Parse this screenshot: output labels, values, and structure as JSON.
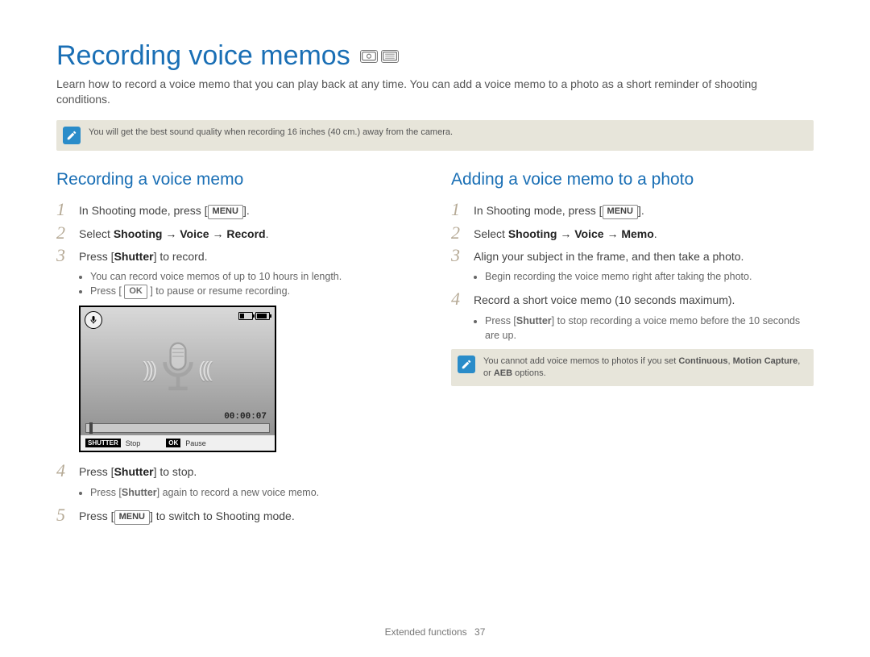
{
  "title": "Recording voice memos",
  "mode_icons": [
    "P",
    "SCENE"
  ],
  "intro": "Learn how to record a voice memo that you can play back at any time. You can add a voice memo to a photo as a short reminder of shooting conditions.",
  "top_note": "You will get the best sound quality when recording 16 inches (40 cm.) away from the camera.",
  "left": {
    "heading": "Recording a voice memo",
    "s1_a": "In Shooting mode, press [",
    "s1_key": "MENU",
    "s1_b": "].",
    "s2_a": "Select ",
    "s2_b": "Shooting → Voice → Record",
    "s2_c": ".",
    "s3_a": "Press [",
    "s3_b": "Shutter",
    "s3_c": "] to record.",
    "b1": "You can record voice memos of up to 10 hours in length.",
    "b2a": "Press [ ",
    "b2key": "OK",
    "b2b": " ] to pause or resume recording.",
    "s4_a": "Press [",
    "s4_b": "Shutter",
    "s4_c": "] to stop.",
    "b3a": "Press [",
    "b3b": "Shutter",
    "b3c": "] again to record a new voice memo.",
    "s5_a": "Press [",
    "s5_key": "MENU",
    "s5_b": "] to switch to Shooting mode."
  },
  "screen": {
    "timecode": "00:00:07",
    "shutter_lbl": "SHUTTER",
    "stop": "Stop",
    "ok_lbl": "OK",
    "pause": "Pause"
  },
  "right": {
    "heading": "Adding a voice memo to a photo",
    "s1_a": "In Shooting mode, press [",
    "s1_key": "MENU",
    "s1_b": "].",
    "s2_a": "Select ",
    "s2_b": "Shooting → Voice → Memo",
    "s2_c": ".",
    "s3": "Align your subject in the frame, and then take a photo.",
    "b1": "Begin recording the voice memo right after taking the photo.",
    "s4": "Record a short voice memo (10 seconds maximum).",
    "b2a": "Press [",
    "b2b": "Shutter",
    "b2c": "] to stop recording a voice memo before the 10 seconds are up.",
    "note_a": "You cannot add voice memos to photos if you set ",
    "note_b": "Continuous",
    "note_c": ", ",
    "note_d": "Motion Capture",
    "note_e": ", or ",
    "note_f": "AEB",
    "note_g": " options."
  },
  "footer": {
    "section": "Extended functions",
    "page": "37"
  }
}
